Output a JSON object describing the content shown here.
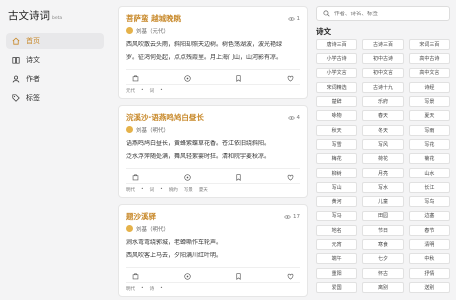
{
  "brand": {
    "title": "古文诗词",
    "badge": "beta"
  },
  "nav": [
    {
      "id": "home",
      "label": "首页",
      "icon": "home-icon",
      "active": true
    },
    {
      "id": "poems",
      "label": "诗文",
      "icon": "book-icon",
      "active": false
    },
    {
      "id": "authors",
      "label": "作者",
      "icon": "user-icon",
      "active": false
    },
    {
      "id": "tags",
      "label": "标签",
      "icon": "tag-icon",
      "active": false
    }
  ],
  "search": {
    "placeholder": "作者、诗名、标签"
  },
  "category": {
    "title": "诗文",
    "items": [
      "唐诗三百",
      "古诗三百",
      "宋词三百",
      "小学古诗",
      "初中古诗",
      "高中古诗",
      "小学文言",
      "初中文言",
      "高中文言",
      "宋词精选",
      "古诗十九",
      "诗经",
      "楚辞",
      "乐府",
      "写景",
      "咏物",
      "春天",
      "夏天",
      "秋天",
      "冬天",
      "写雨",
      "写雪",
      "写风",
      "写花",
      "梅花",
      "荷花",
      "菊花",
      "柳树",
      "月亮",
      "山水",
      "写山",
      "写水",
      "长江",
      "黄河",
      "儿童",
      "写鸟",
      "写马",
      "田园",
      "边塞",
      "地名",
      "节日",
      "春节",
      "元宵",
      "寒食",
      "清明",
      "端午",
      "七夕",
      "中秋",
      "重阳",
      "怀古",
      "抒情",
      "爱国",
      "离别",
      "送别"
    ]
  },
  "poems": [
    {
      "title": "菩萨蛮  越城晚眺",
      "views": "1",
      "author": "刘基（元代）",
      "lines": [
        "西风吹散云头雨，斜阳却照天边树。树色荡湖波，波光艳绿",
        "罗。征鸿何处起，点点残霞里。月上海门山，山河影有凉。"
      ],
      "tags": [
        "元代",
        "词"
      ]
    },
    {
      "title": "浣溪沙·语燕鸣鸠白昼长",
      "views": "4",
      "author": "刘基（明代）",
      "lines": [
        "语燕鸣鸠白昼长，黄蜂紫蝶草花香。苍江依旧绕斜阳。",
        "泛水浮萍随处满，舞风轻絮霎时狂。清和院宇麦秋凉。"
      ],
      "tags": [
        "明代",
        "词",
        "婉约",
        "写景",
        "夏天"
      ]
    },
    {
      "title": "题沙溪驿",
      "views": "17",
      "author": "刘基（明代）",
      "lines": [
        "涧水弯弯绕郭城，老蝉嘶作车轮声。",
        "西风吹客上马去，夕阳满川红叶明。"
      ],
      "tags": [
        "明代",
        "诗"
      ]
    }
  ],
  "colors": {
    "accent": "#c8892a",
    "avatar": "#e5b24a"
  }
}
